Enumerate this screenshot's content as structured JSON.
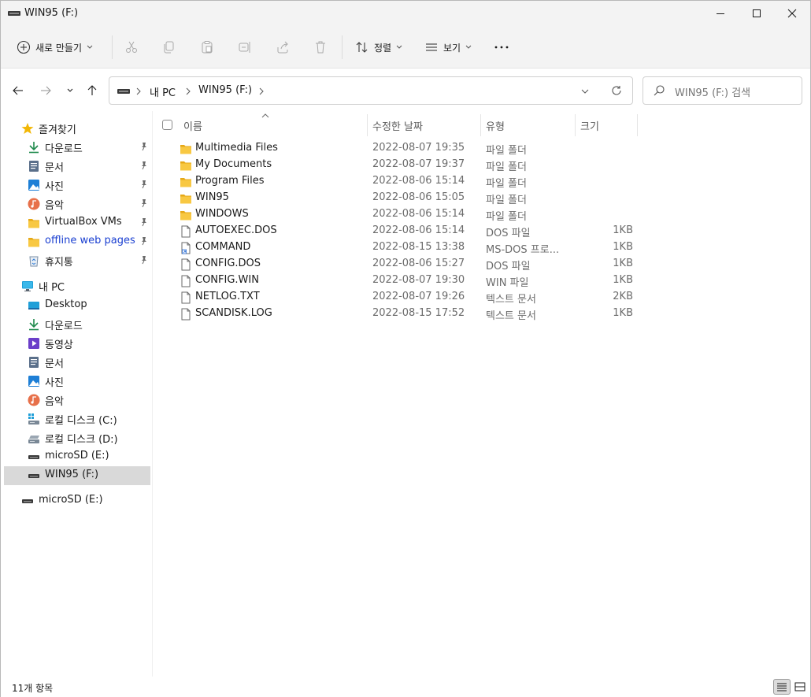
{
  "window": {
    "title": "WIN95 (F:)"
  },
  "commandbar": {
    "new_label": "새로 만들기",
    "sort_label": "정렬",
    "view_label": "보기",
    "more_label": "···"
  },
  "address": {
    "crumbs": [
      "내 PC",
      "WIN95 (F:)"
    ],
    "search_placeholder": "WIN95 (F:) 검색"
  },
  "nav": {
    "quick_access": {
      "label": "즐겨찾기",
      "items": [
        {
          "label": "다운로드",
          "icon": "download-arrow-icon",
          "pinned": true
        },
        {
          "label": "문서",
          "icon": "document-icon",
          "pinned": true
        },
        {
          "label": "사진",
          "icon": "pictures-icon",
          "pinned": true
        },
        {
          "label": "음악",
          "icon": "music-icon",
          "pinned": true
        },
        {
          "label": "VirtualBox VMs",
          "icon": "folder-icon",
          "pinned": true
        },
        {
          "label": "offline web pages",
          "icon": "folder-icon",
          "pinned": true
        },
        {
          "label": "휴지통",
          "icon": "recycle-bin-icon",
          "pinned": true
        }
      ]
    },
    "this_pc": {
      "label": "내 PC",
      "items": [
        {
          "label": "Desktop",
          "icon": "desktop-icon"
        },
        {
          "label": "다운로드",
          "icon": "download-arrow-icon"
        },
        {
          "label": "동영상",
          "icon": "video-icon"
        },
        {
          "label": "문서",
          "icon": "document-icon"
        },
        {
          "label": "사진",
          "icon": "pictures-icon"
        },
        {
          "label": "음악",
          "icon": "music-icon"
        },
        {
          "label": "로컬 디스크 (C:)",
          "icon": "windows-drive-icon"
        },
        {
          "label": "로컬 디스크 (D:)",
          "icon": "drive-icon"
        },
        {
          "label": "microSD (E:)",
          "icon": "removable-drive-icon"
        },
        {
          "label": "WIN95 (F:)",
          "icon": "removable-drive-icon",
          "selected": true
        }
      ]
    },
    "extra": {
      "label": "microSD (E:)",
      "icon": "removable-drive-icon"
    }
  },
  "columns": {
    "name": "이름",
    "date": "수정한 날짜",
    "type": "유형",
    "size": "크기"
  },
  "files": [
    {
      "name": "Multimedia Files",
      "date": "2022-08-07 19:35",
      "type": "파일 폴더",
      "size": "",
      "icon": "folder-icon"
    },
    {
      "name": "My Documents",
      "date": "2022-08-07 19:37",
      "type": "파일 폴더",
      "size": "",
      "icon": "folder-icon"
    },
    {
      "name": "Program Files",
      "date": "2022-08-06 15:14",
      "type": "파일 폴더",
      "size": "",
      "icon": "folder-icon"
    },
    {
      "name": "WIN95",
      "date": "2022-08-06 15:05",
      "type": "파일 폴더",
      "size": "",
      "icon": "folder-icon"
    },
    {
      "name": "WINDOWS",
      "date": "2022-08-06 15:14",
      "type": "파일 폴더",
      "size": "",
      "icon": "folder-icon"
    },
    {
      "name": "AUTOEXEC.DOS",
      "date": "2022-08-06 15:14",
      "type": "DOS 파일",
      "size": "1KB",
      "icon": "file-icon"
    },
    {
      "name": "COMMAND",
      "date": "2022-08-15 13:38",
      "type": "MS-DOS 프로...",
      "size": "1KB",
      "icon": "shortcut-file-icon"
    },
    {
      "name": "CONFIG.DOS",
      "date": "2022-08-06 15:27",
      "type": "DOS 파일",
      "size": "1KB",
      "icon": "file-icon"
    },
    {
      "name": "CONFIG.WIN",
      "date": "2022-08-07 19:30",
      "type": "WIN 파일",
      "size": "1KB",
      "icon": "file-icon"
    },
    {
      "name": "NETLOG.TXT",
      "date": "2022-08-07 19:26",
      "type": "텍스트 문서",
      "size": "2KB",
      "icon": "file-icon"
    },
    {
      "name": "SCANDISK.LOG",
      "date": "2022-08-15 17:52",
      "type": "텍스트 문서",
      "size": "1KB",
      "icon": "file-icon"
    }
  ],
  "status": {
    "count_text": "11개 항목"
  },
  "colors": {
    "folder": "#f8c842",
    "selection": "#d9d9d9",
    "link": "#1a3fd1",
    "accent": "#0067c0"
  }
}
